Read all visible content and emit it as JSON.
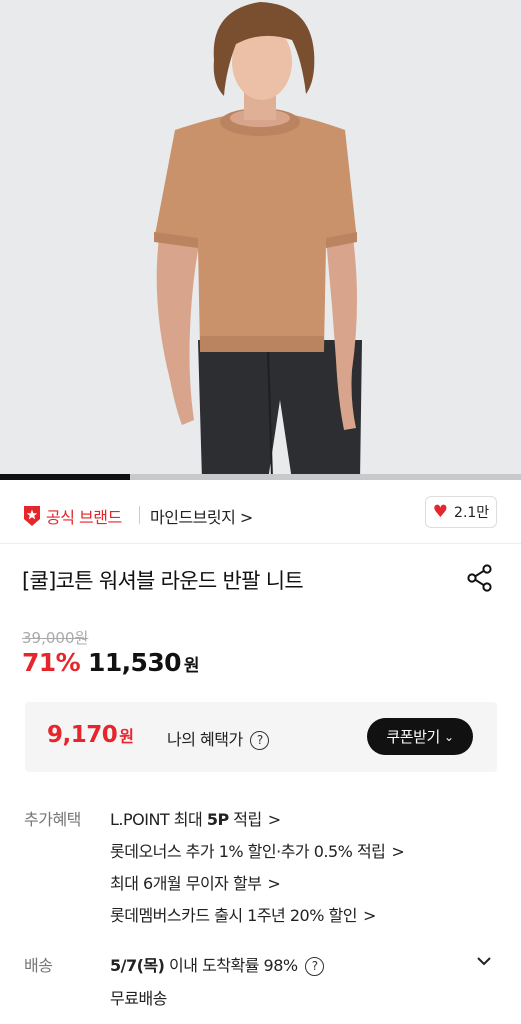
{
  "carousel": {
    "progress": 0.25
  },
  "brand": {
    "official_label": "공식 브랜드",
    "name": "마인드브릿지",
    "chevron": ">",
    "like_count": "2.1만"
  },
  "product": {
    "title": "[쿨]코튼 워셔블 라운드 반팔 니트",
    "original_price": "39,000원",
    "discount": "71%",
    "sale_price": "11,530",
    "currency": "원"
  },
  "my_benefit": {
    "price": "9,170",
    "currency": "원",
    "label": "나의 혜택가",
    "help": "?",
    "coupon_button": "쿠폰받기",
    "coupon_chevron": "⌄"
  },
  "extra_benefits": {
    "label": "추가혜택",
    "items": [
      {
        "prefix": "L.POINT 최대 ",
        "bold": "5P",
        "suffix": " 적립",
        "arrow": ">"
      },
      {
        "prefix": "롯데오너스 추가 1% 할인·추가 0.5% 적립",
        "bold": "",
        "suffix": "",
        "arrow": ">"
      },
      {
        "prefix": "최대 6개월 무이자 할부",
        "bold": "",
        "suffix": "",
        "arrow": ">"
      },
      {
        "prefix": "롯데멤버스카드 출시 1주년 20% 할인",
        "bold": "",
        "suffix": "",
        "arrow": ">"
      }
    ]
  },
  "shipping": {
    "label": "배송",
    "date": "5/7(목)",
    "text": " 이내 도착확률 98%",
    "help": "?",
    "free": "무료배송"
  }
}
